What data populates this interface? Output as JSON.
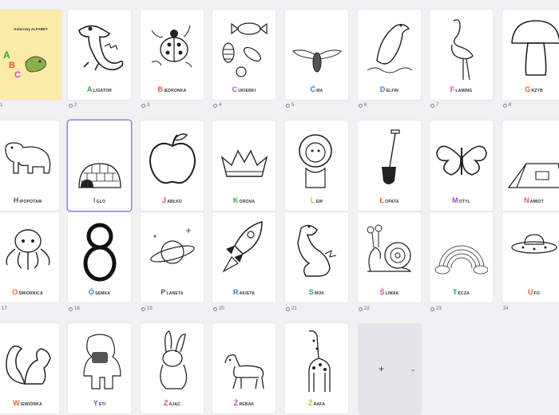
{
  "cover": {
    "title": "Kolorowy ALFABET",
    "letters": [
      "A",
      "B",
      "C"
    ],
    "page": "1"
  },
  "pages": [
    {
      "page": "2",
      "initial": "A",
      "rest": "LIGATOR",
      "color": "#2ea44f"
    },
    {
      "page": "3",
      "initial": "B",
      "rest": "IEDRONKA",
      "color": "#e05a3a"
    },
    {
      "page": "4",
      "initial": "C",
      "rest": "UKIERKI",
      "color": "#c04ad6"
    },
    {
      "page": "5",
      "initial": "Ć",
      "rest": "MA",
      "color": "#2a7ad8"
    },
    {
      "page": "6",
      "initial": "D",
      "rest": "ELFIN",
      "color": "#3b7fd9"
    },
    {
      "page": "7",
      "initial": "F",
      "rest": "LAMING",
      "color": "#d94aa8"
    },
    {
      "page": "8",
      "initial": "G",
      "rest": "RZYB",
      "color": "#e06a2a"
    },
    {
      "page": "",
      "initial": "H",
      "rest": "IPOPOTAM",
      "color": "#555555"
    },
    {
      "page": "",
      "initial": "I",
      "rest": "GLO",
      "color": "#3b7fd9"
    },
    {
      "page": "",
      "initial": "J",
      "rest": "ABŁKO",
      "color": "#e04a4a"
    },
    {
      "page": "",
      "initial": "K",
      "rest": "ORONA",
      "color": "#2ea44f"
    },
    {
      "page": "",
      "initial": "L",
      "rest": "EW",
      "color": "#e0b02a"
    },
    {
      "page": "",
      "initial": "Ł",
      "rest": "OPATA",
      "color": "#e06a2a"
    },
    {
      "page": "",
      "initial": "M",
      "rest": "OTYL",
      "color": "#9b4ad6"
    },
    {
      "page": "",
      "initial": "N",
      "rest": "AMIOT",
      "color": "#d94aa8"
    },
    {
      "page": "17",
      "initial": "O",
      "rest": "ŚMIORNICA",
      "color": "#e06a2a"
    },
    {
      "page": "18",
      "initial": "Ó",
      "rest": "SEMKA",
      "color": "#2a7ad8"
    },
    {
      "page": "19",
      "initial": "P",
      "rest": "LANETA",
      "color": "#555555"
    },
    {
      "page": "20",
      "initial": "R",
      "rest": "AKIETA",
      "color": "#2a7ad8"
    },
    {
      "page": "21",
      "initial": "S",
      "rest": "MOK",
      "color": "#2ea44f"
    },
    {
      "page": "22",
      "initial": "Ś",
      "rest": "LIMAK",
      "color": "#d94aa8"
    },
    {
      "page": "23",
      "initial": "T",
      "rest": "ĘCZA",
      "color": "#2ea44f"
    },
    {
      "page": "24",
      "initial": "U",
      "rest": "FO",
      "color": "#e06a2a"
    },
    {
      "page": "",
      "initial": "W",
      "rest": "IEWIÓRKA",
      "color": "#e06a2a"
    },
    {
      "page": "",
      "initial": "Y",
      "rest": "ETI",
      "color": "#3b7fd9"
    },
    {
      "page": "",
      "initial": "Z",
      "rest": "AJĄC",
      "color": "#e04a4a"
    },
    {
      "page": "",
      "initial": "Ż",
      "rest": "REBAK",
      "color": "#9b4ad6"
    },
    {
      "page": "",
      "initial": "Ź",
      "rest": "RAFA",
      "color": "#e0b02a"
    }
  ],
  "add_page": {
    "plus": "+",
    "chevron": "⌄"
  },
  "icons": [
    "comment-icon",
    "add-icon",
    "chevron-down-icon"
  ]
}
